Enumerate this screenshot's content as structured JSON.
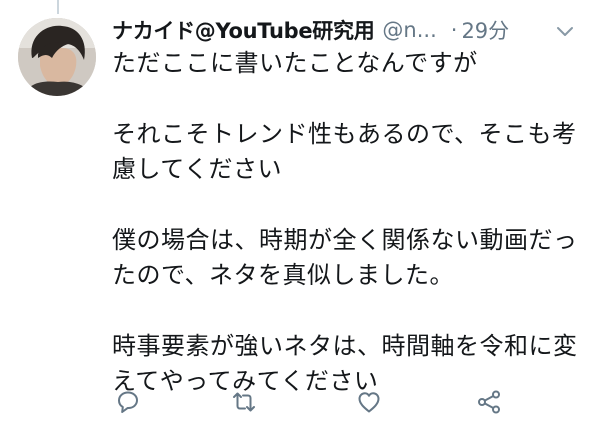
{
  "tweet": {
    "display_name": "ナカイド@YouTube研究用",
    "handle": "@n...",
    "separator": "·",
    "time": "29分",
    "lines": [
      "ただここに書いたことなんですが",
      "",
      "それこそトレンド性もあるので、そこも考",
      "慮してください",
      "",
      "僕の場合は、時期が全く関係ない動画だっ",
      "たので、ネタを真似しました。",
      "",
      "時事要素が強いネタは、時間軸を令和に変",
      "えてやってみてください"
    ]
  },
  "icons": {
    "caret": "chevron-down-icon",
    "reply": "reply-icon",
    "retweet": "retweet-icon",
    "like": "heart-icon",
    "share": "share-icon"
  },
  "colors": {
    "text": "#14171a",
    "secondary": "#657786",
    "icon": "#657786",
    "thread_line": "#ccd6dd"
  }
}
